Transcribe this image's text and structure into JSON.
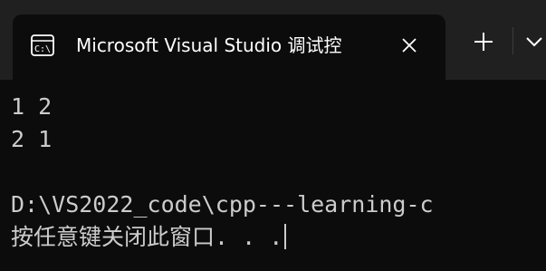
{
  "window": {
    "tab_title": "Microsoft Visual Studio 调试控",
    "tab_icon": "console-icon",
    "close_icon": "close-icon",
    "new_tab_icon": "plus-icon",
    "dropdown_icon": "chevron-down-icon"
  },
  "terminal": {
    "lines": [
      "1 2",
      "2 1",
      "",
      "D:\\VS2022_code\\cpp---learning-c",
      "按任意键关闭此窗口. . ."
    ]
  },
  "colors": {
    "background": "#0c0c0c",
    "titlebar": "#202020",
    "text": "#cccccc"
  }
}
